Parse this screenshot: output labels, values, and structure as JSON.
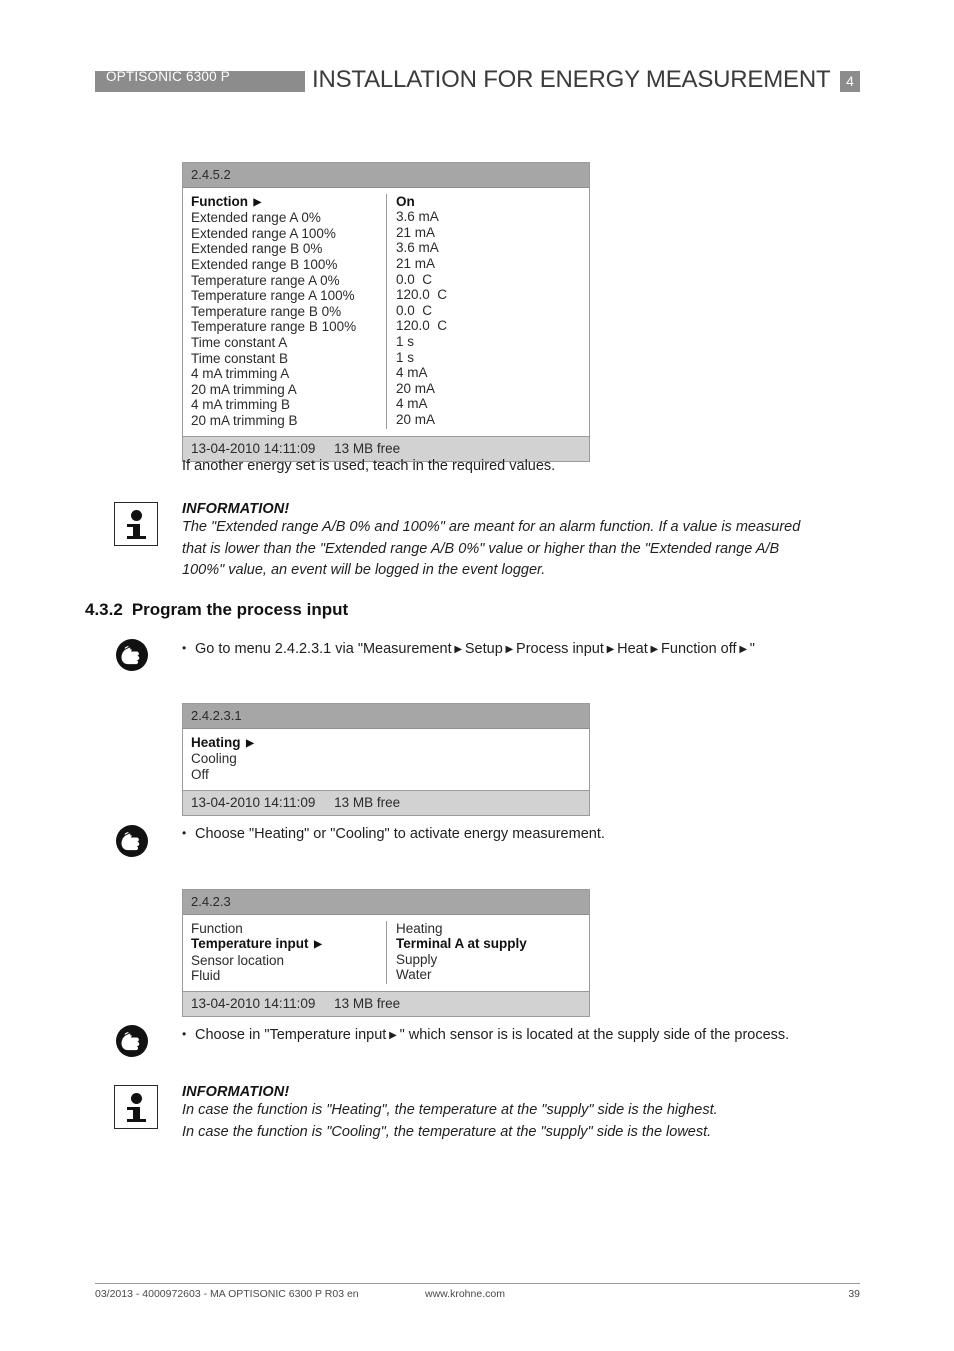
{
  "header": {
    "tag": "OPTISONIC 6300 P",
    "title": "INSTALLATION FOR ENERGY MEASUREMENT",
    "chapter": "4"
  },
  "table1": {
    "menu_number": "2.4.5.2",
    "rows": [
      {
        "label": "Function",
        "value": "On",
        "bold": true,
        "arrow": true
      },
      {
        "label": "Extended range A 0%",
        "value": "3.6 mA",
        "bold": false,
        "arrow": false
      },
      {
        "label": "Extended range A 100%",
        "value": "21 mA",
        "bold": false,
        "arrow": false
      },
      {
        "label": "Extended range B 0%",
        "value": "3.6 mA",
        "bold": false,
        "arrow": false
      },
      {
        "label": "Extended range B 100%",
        "value": "21 mA",
        "bold": false,
        "arrow": false
      },
      {
        "label": "Temperature range A 0%",
        "value": "0.0  C",
        "bold": false,
        "arrow": false
      },
      {
        "label": "Temperature range A 100%",
        "value": "120.0  C",
        "bold": false,
        "arrow": false
      },
      {
        "label": "Temperature range B 0%",
        "value": "0.0  C",
        "bold": false,
        "arrow": false
      },
      {
        "label": "Temperature range B 100%",
        "value": "120.0  C",
        "bold": false,
        "arrow": false
      },
      {
        "label": "Time constant A",
        "value": "1 s",
        "bold": false,
        "arrow": false
      },
      {
        "label": "Time constant B",
        "value": "1 s",
        "bold": false,
        "arrow": false
      },
      {
        "label": "4 mA trimming A",
        "value": "4 mA",
        "bold": false,
        "arrow": false
      },
      {
        "label": "20 mA trimming A",
        "value": "20 mA",
        "bold": false,
        "arrow": false
      },
      {
        "label": "4 mA trimming B",
        "value": "4 mA",
        "bold": false,
        "arrow": false
      },
      {
        "label": "20 mA trimming B",
        "value": "20 mA",
        "bold": false,
        "arrow": false
      }
    ],
    "status": "13-04-2010 14:11:09     13 MB free"
  },
  "paragraph1": "If another energy set is used, teach in the required values.",
  "info1": {
    "title": "INFORMATION!",
    "lines": [
      " The \"Extended range A/B 0% and 100%\" are meant for an alarm function. If a value is measured",
      "that is lower than the \"Extended range A/B 0%\" value or higher than the \"Extended range A/B",
      "100%\" value, an event will be logged in the event logger."
    ]
  },
  "section": {
    "number": "4.3.2",
    "title": "Program the process input"
  },
  "bullet1": {
    "text_before": "Go to menu 2.4.2.3.1 via \"Measurement",
    "crumbs": [
      "Setup",
      "Process input",
      "Heat",
      "Function off"
    ],
    "text_after": "\""
  },
  "table2": {
    "menu_number": "2.4.2.3.1",
    "rows": [
      {
        "label": "Heating",
        "value": "",
        "bold": true,
        "arrow": true
      },
      {
        "label": "Cooling",
        "value": "",
        "bold": false,
        "arrow": false
      },
      {
        "label": "Off",
        "value": "",
        "bold": false,
        "arrow": false
      }
    ],
    "status": "13-04-2010 14:11:09     13 MB free"
  },
  "bullet2": "Choose \"Heating\" or \"Cooling\" to activate energy measurement.",
  "table3": {
    "menu_number": "2.4.2.3",
    "rows": [
      {
        "label": "Function",
        "value": "Heating",
        "bold": false,
        "arrow": false
      },
      {
        "label": "Temperature input",
        "value": "Terminal A at supply",
        "bold": true,
        "arrow": true
      },
      {
        "label": "Sensor location",
        "value": "Supply",
        "bold": false,
        "arrow": false
      },
      {
        "label": "Fluid",
        "value": "Water",
        "bold": false,
        "arrow": false
      }
    ],
    "status": "13-04-2010 14:11:09     13 MB free"
  },
  "bullet3": {
    "text_before": "Choose in  \"Temperature input",
    "text_after": "\" which sensor is is located at the supply side of the process."
  },
  "info2": {
    "title": "INFORMATION!",
    "lines": [
      " In case the function is \"Heating\", the temperature at the \"supply\" side is the highest.",
      "In case the function is \"Cooling\", the temperature at the \"supply\" side is the lowest."
    ]
  },
  "footer": {
    "left": "03/2013 - 4000972603 - MA OPTISONIC 6300 P R03 en",
    "middle": "www.krohne.com",
    "page": "39"
  },
  "icons": {
    "info": "information-i-icon",
    "instruction": "pointing-hand-icon",
    "arrow": "menu-arrow-icon"
  }
}
